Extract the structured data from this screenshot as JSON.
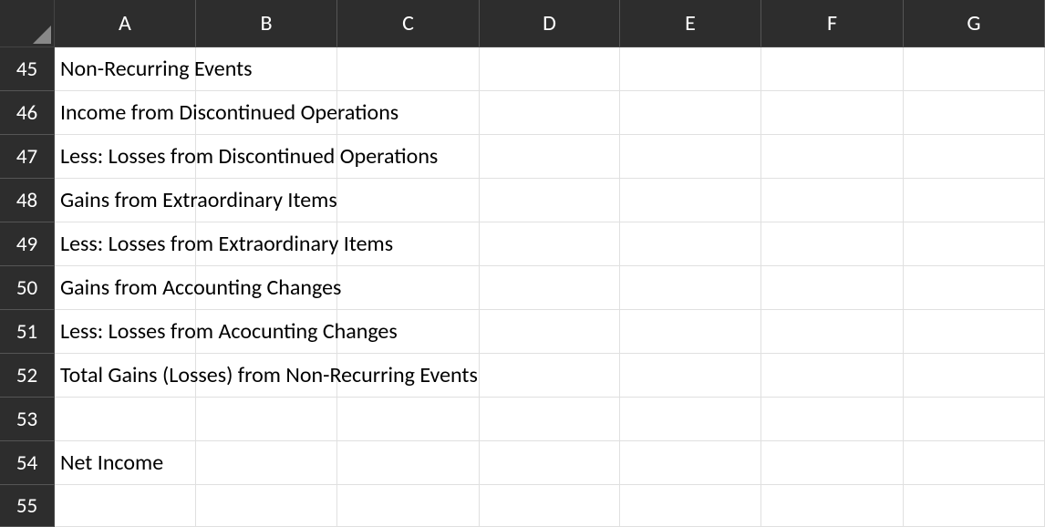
{
  "columns": [
    "A",
    "B",
    "C",
    "D",
    "E",
    "F",
    "G"
  ],
  "rows": [
    {
      "num": "45",
      "cells": [
        "Non-Recurring Events",
        "",
        "",
        "",
        "",
        "",
        ""
      ]
    },
    {
      "num": "46",
      "cells": [
        "Income from Discontinued Operations",
        "",
        "",
        "",
        "",
        "",
        ""
      ]
    },
    {
      "num": "47",
      "cells": [
        "Less: Losses from Discontinued Operations",
        "",
        "",
        "",
        "",
        "",
        ""
      ]
    },
    {
      "num": "48",
      "cells": [
        "Gains from Extraordinary Items",
        "",
        "",
        "",
        "",
        "",
        ""
      ]
    },
    {
      "num": "49",
      "cells": [
        "Less: Losses from Extraordinary Items",
        "",
        "",
        "",
        "",
        "",
        ""
      ]
    },
    {
      "num": "50",
      "cells": [
        "Gains from Accounting Changes",
        "",
        "",
        "",
        "",
        "",
        ""
      ]
    },
    {
      "num": "51",
      "cells": [
        "Less: Losses from Acocunting Changes",
        "",
        "",
        "",
        "",
        "",
        ""
      ]
    },
    {
      "num": "52",
      "cells": [
        "Total Gains (Losses) from Non-Recurring Events",
        "",
        "",
        "",
        "",
        "",
        ""
      ]
    },
    {
      "num": "53",
      "cells": [
        "",
        "",
        "",
        "",
        "",
        "",
        ""
      ]
    },
    {
      "num": "54",
      "cells": [
        "Net Income",
        "",
        "",
        "",
        "",
        "",
        ""
      ]
    },
    {
      "num": "55",
      "cells": [
        "",
        "",
        "",
        "",
        "",
        "",
        ""
      ]
    }
  ]
}
